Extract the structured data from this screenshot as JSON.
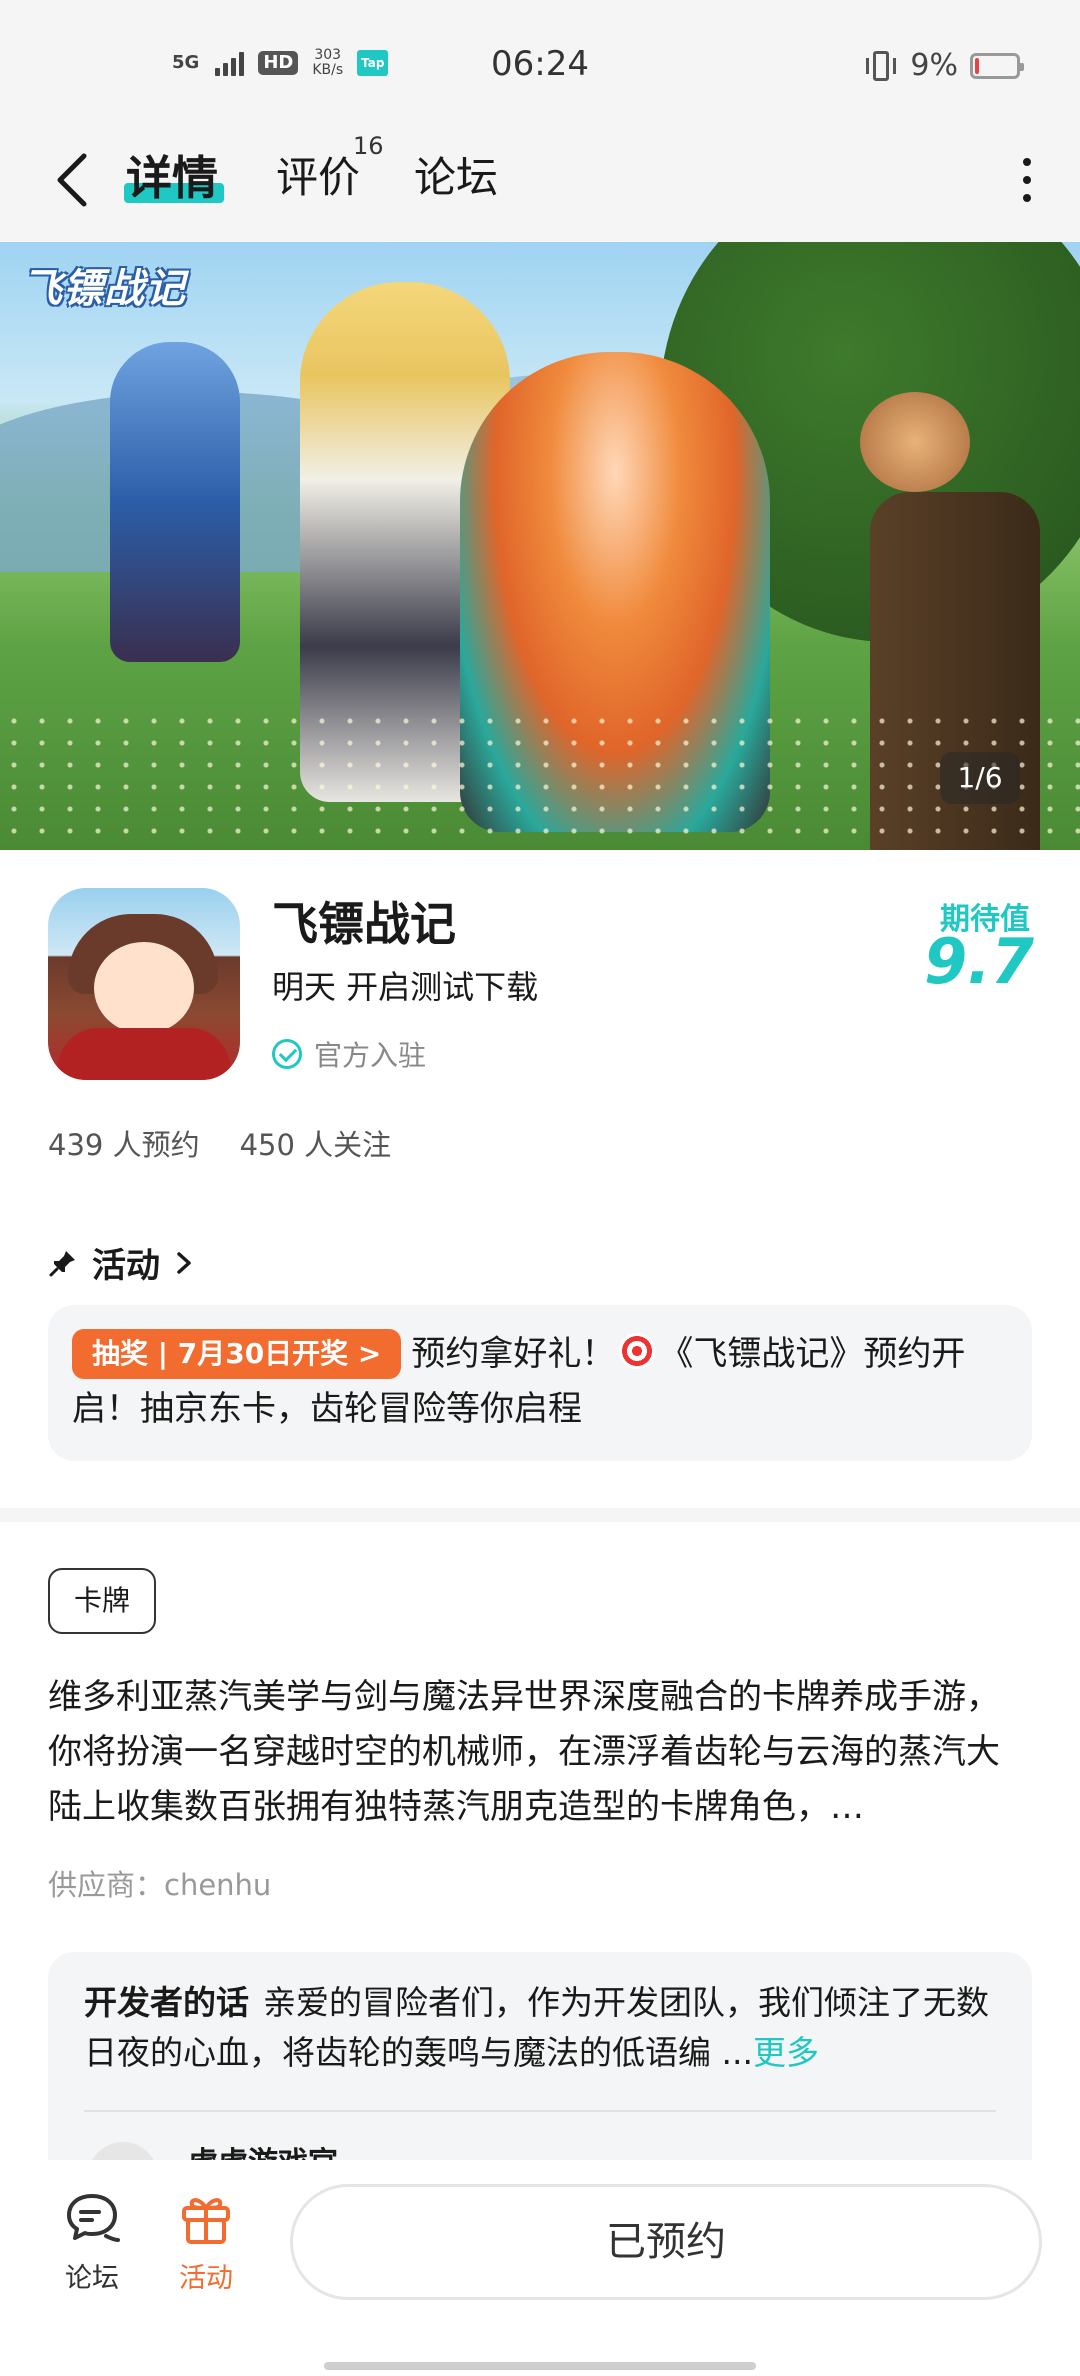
{
  "status_bar": {
    "network": "5G",
    "hd": "HD",
    "speed_value": "303",
    "speed_unit": "KB/s",
    "app_badge": "Tap",
    "time": "06:24",
    "battery_percent": "9%",
    "battery_level": 0.09,
    "battery_color": "#e84343"
  },
  "header": {
    "tabs": [
      {
        "label": "详情",
        "active": true
      },
      {
        "label": "评价",
        "count": "16"
      },
      {
        "label": "论坛"
      }
    ],
    "back_icon": "chevron-left-icon",
    "more_icon": "more-vertical-icon"
  },
  "banner": {
    "logo_text": "飞镖战记",
    "page_indicator": "1/6"
  },
  "app": {
    "name": "飞镖战记",
    "status": "明天 开启测试下载",
    "verified_label": "官方入驻",
    "expect_label": "期待值",
    "expect_score": "9.7",
    "reservations": "439 人预约",
    "followers": "450 人关注"
  },
  "activity": {
    "title": "活动",
    "badge": "抽奖 | 7月30日开奖 >",
    "text_part1": "预约拿好礼！",
    "text_part2": "《飞镖战记》预约开启！抽京东卡，齿轮冒险等你启程"
  },
  "description": {
    "tag": "卡牌",
    "text": "维多利亚蒸汽美学与剑与魔法异世界深度融合的卡牌养成手游，你将扮演一名穿越时空的机械师，在漂浮着齿轮与云海的蒸汽大陆上收集数百张拥有独特蒸汽朋克造型的卡牌角色，…",
    "supplier": "供应商：chenhu"
  },
  "developer_note": {
    "title": "开发者的话",
    "text": "亲爱的冒险者们，作为开发团队，我们倾注了无数日夜的心血，将齿轮的轰鸣与魔法的低语编 ...",
    "more": "更多",
    "author": "虎虎游戏官"
  },
  "bottom_bar": {
    "forum_label": "论坛",
    "activity_label": "活动",
    "reserved_label": "已预约"
  },
  "colors": {
    "accent": "#1fc8c2",
    "orange": "#f26b2f"
  }
}
